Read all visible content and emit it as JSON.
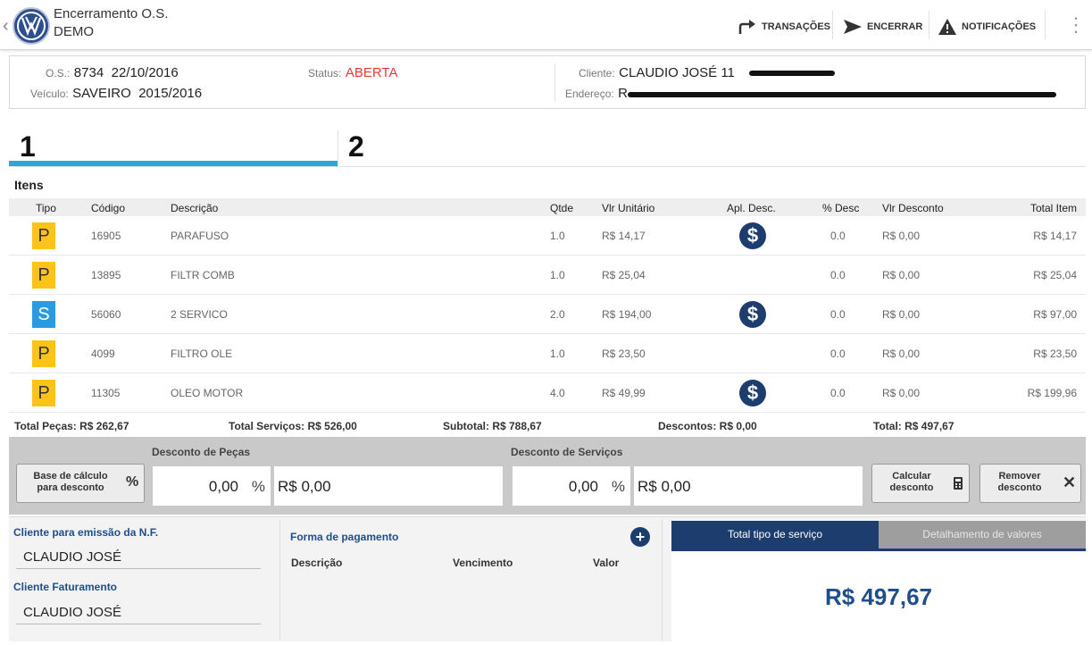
{
  "header": {
    "title": "Encerramento O.S.",
    "subtitle": "DEMO",
    "actions": {
      "transacoes": "TRANSAÇÕES",
      "encerrar": "ENCERRAR",
      "notificacoes": "NOTIFICAÇÕES"
    }
  },
  "info": {
    "os_label": "O.S.:",
    "os_number": "8734",
    "os_date": "22/10/2016",
    "veiculo_label": "Veículo:",
    "veiculo": "SAVEIRO",
    "veiculo_ano": "2015/2016",
    "status_label": "Status:",
    "status": "ABERTA",
    "cliente_label": "Cliente:",
    "cliente": "CLAUDIO JOSÉ 11",
    "endereco_label": "Endereço:",
    "endereco": "R"
  },
  "tabs": [
    "1",
    "2"
  ],
  "items": {
    "title": "Itens",
    "columns": {
      "tipo": "Tipo",
      "codigo": "Código",
      "descricao": "Descrição",
      "qtde": "Qtde",
      "vlr_unitario": "Vlr Unitário",
      "apl_desc": "Apl. Desc.",
      "pct_desc": "% Desc",
      "vlr_desconto": "Vlr Desconto",
      "total_item": "Total Item"
    },
    "rows": [
      {
        "tipo": "P",
        "codigo": "16905",
        "descricao": "PARAFUSO",
        "qtde": "1.0",
        "vlr_unitario": "R$ 14,17",
        "apl_desc": true,
        "pct_desc": "0.0",
        "vlr_desconto": "R$ 0,00",
        "total_item": "R$ 14,17"
      },
      {
        "tipo": "P",
        "codigo": "13895",
        "descricao": "FILTR COMB",
        "qtde": "1.0",
        "vlr_unitario": "R$ 25,04",
        "apl_desc": false,
        "pct_desc": "0.0",
        "vlr_desconto": "R$ 0,00",
        "total_item": "R$ 25,04"
      },
      {
        "tipo": "S",
        "codigo": "56060",
        "descricao": "2 SERVICO",
        "qtde": "2.0",
        "vlr_unitario": "R$ 194,00",
        "apl_desc": true,
        "pct_desc": "0.0",
        "vlr_desconto": "R$ 0,00",
        "total_item": "R$ 97,00"
      },
      {
        "tipo": "P",
        "codigo": "4099",
        "descricao": "FILTRO OLE",
        "qtde": "1.0",
        "vlr_unitario": "R$ 23,50",
        "apl_desc": false,
        "pct_desc": "0.0",
        "vlr_desconto": "R$ 0,00",
        "total_item": "R$ 23,50"
      },
      {
        "tipo": "P",
        "codigo": "11305",
        "descricao": "OLEO MOTOR",
        "qtde": "4.0",
        "vlr_unitario": "R$ 49,99",
        "apl_desc": true,
        "pct_desc": "0.0",
        "vlr_desconto": "R$ 0,00",
        "total_item": "R$ 199,96"
      }
    ]
  },
  "totals": {
    "pecas": "Total Peças: R$ 262,67",
    "servicos": "Total Serviços: R$ 526,00",
    "subtotal": "Subtotal: R$ 788,67",
    "descontos": "Descontos: R$ 0,00",
    "total_label": "Total:",
    "total_value": "R$ 497,67"
  },
  "discount": {
    "base_button": "Base de cálculo para desconto",
    "base_icon": "%",
    "pecas_label": "Desconto de Peças",
    "pecas_pct": "0,00",
    "pecas_value": "R$ 0,00",
    "servicos_label": "Desconto de Serviços",
    "servicos_pct": "0,00",
    "servicos_value": "R$ 0,00",
    "pct_symbol": "%",
    "calcular_button": "Calcular desconto",
    "remover_button": "Remover desconto"
  },
  "billing": {
    "nf_label": "Cliente para emissão da N.F.",
    "nf_value": "CLAUDIO JOSÉ",
    "faturamento_label": "Cliente Faturamento",
    "faturamento_value": "CLAUDIO JOSÉ"
  },
  "payment": {
    "title": "Forma de pagamento",
    "col_descricao": "Descrição",
    "col_vencimento": "Vencimento",
    "col_valor": "Valor"
  },
  "summary": {
    "tab_total": "Total tipo de serviço",
    "tab_detail": "Detalhamento de valores",
    "total": "R$ 497,67"
  },
  "colors": {
    "accent_blue": "#1c3d6e",
    "tab_line": "#2aa8dc",
    "status_red": "#e53935",
    "peca_yellow": "#fcc419",
    "servico_blue": "#2a9be0"
  }
}
